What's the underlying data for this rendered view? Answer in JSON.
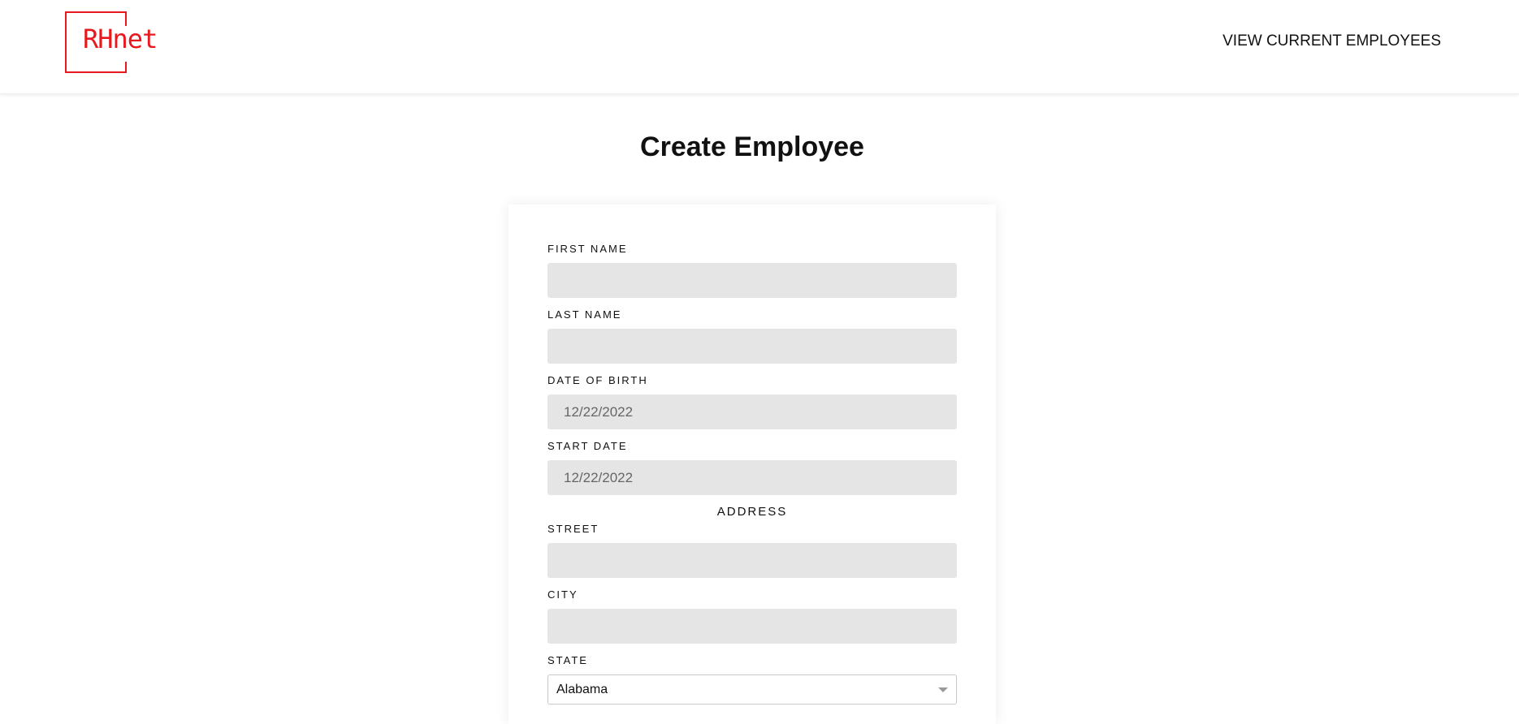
{
  "header": {
    "logo_text": "RHnet",
    "nav_link": "VIEW CURRENT EMPLOYEES",
    "brand_color": "#e8191e"
  },
  "page": {
    "title": "Create Employee"
  },
  "form": {
    "first_name": {
      "label": "FIRST NAME",
      "value": ""
    },
    "last_name": {
      "label": "LAST NAME",
      "value": ""
    },
    "date_of_birth": {
      "label": "DATE OF BIRTH",
      "value": "12/22/2022"
    },
    "start_date": {
      "label": "START DATE",
      "value": "12/22/2022"
    },
    "address_section": "ADDRESS",
    "street": {
      "label": "STREET",
      "value": ""
    },
    "city": {
      "label": "CITY",
      "value": ""
    },
    "state": {
      "label": "STATE",
      "value": "Alabama"
    }
  }
}
